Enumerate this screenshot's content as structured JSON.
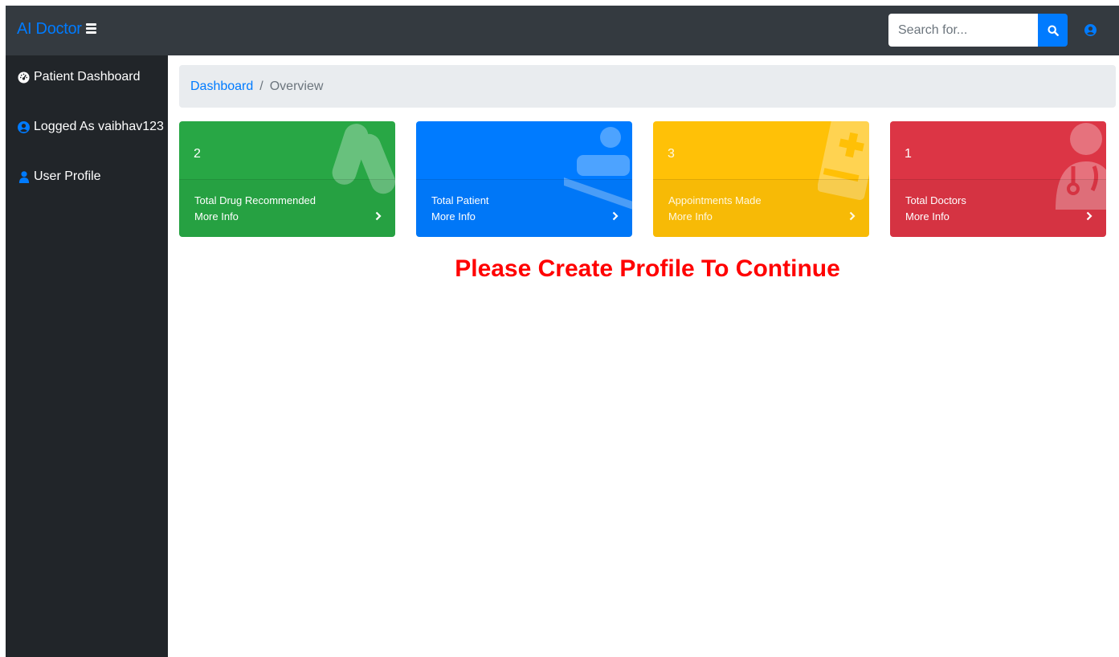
{
  "app": {
    "brand": "AI Doctor"
  },
  "navbar": {
    "search_placeholder": "Search for..."
  },
  "sidebar": {
    "items": [
      {
        "label": "Patient Dashboard",
        "icon": "tachometer-icon"
      },
      {
        "label": "Logged As vaibhav123",
        "icon": "user-circle-icon"
      },
      {
        "label": "User Profile",
        "icon": "user-icon"
      }
    ]
  },
  "breadcrumb": {
    "link": "Dashboard",
    "separator": "/",
    "active": "Overview"
  },
  "cards": [
    {
      "count": "2",
      "label": "Total Drug Recommended",
      "more": "More Info",
      "color": "#28a745",
      "icon": "capsules-icon"
    },
    {
      "count": "",
      "label": "Total Patient",
      "more": "More Info",
      "color": "#007bff",
      "icon": "procedures-icon"
    },
    {
      "count": "3",
      "label": "Appointments Made",
      "more": "More Info",
      "color": "#ffc107",
      "icon": "notes-medical-icon"
    },
    {
      "count": "1",
      "label": "Total Doctors",
      "more": "More Info",
      "color": "#dc3545",
      "icon": "user-md-icon"
    }
  ],
  "notice": "Please Create Profile To Continue",
  "colors": {
    "navbar": "#343a40",
    "sidebar": "#212529",
    "accent": "#007bff",
    "notice": "#ff0000"
  }
}
